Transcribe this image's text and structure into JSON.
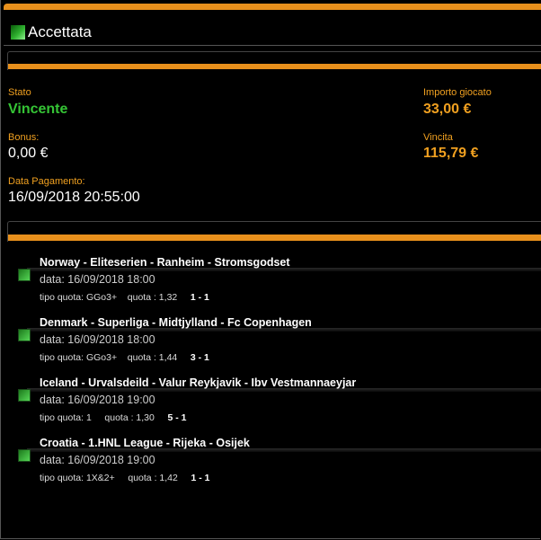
{
  "header": {
    "status_title": "Accettata"
  },
  "summary": {
    "stato_label": "Stato",
    "stato_value": "Vincente",
    "importo_label": "Importo giocato",
    "importo_value": "33,00 €",
    "bonus_label": "Bonus:",
    "bonus_value": "0,00 €",
    "vincita_label": "Vincita",
    "vincita_value": "115,79 €",
    "data_pagamento_label": "Data Pagamento:",
    "data_pagamento_value": "16/09/2018 20:55:00"
  },
  "events": [
    {
      "title": "Norway - Eliteserien - Ranheim - Stromsgodset",
      "date": "data: 16/09/2018 18:00",
      "tipo_quota": "tipo quota: GGo3+",
      "quota": "quota : 1,32",
      "score": "1 - 1"
    },
    {
      "title": "Denmark - Superliga - Midtjylland - Fc Copenhagen",
      "date": "data: 16/09/2018 18:00",
      "tipo_quota": "tipo quota: GGo3+",
      "quota": "quota : 1,44",
      "score": "3 - 1"
    },
    {
      "title": "Iceland - Urvalsdeild - Valur Reykjavik - Ibv Vestmannaeyjar",
      "date": "data: 16/09/2018 19:00",
      "tipo_quota": "tipo quota: 1",
      "quota": "quota : 1,30",
      "score": "5 - 1"
    },
    {
      "title": "Croatia - 1.HNL League - Rijeka - Osijek",
      "date": "data: 16/09/2018 19:00",
      "tipo_quota": "tipo quota: 1X&2+",
      "quota": "quota : 1,42",
      "score": "1 - 1"
    }
  ],
  "colors": {
    "accent": "#e8901c",
    "win_green": "#35c435",
    "label_orange": "#f0a020",
    "background": "#000000"
  }
}
